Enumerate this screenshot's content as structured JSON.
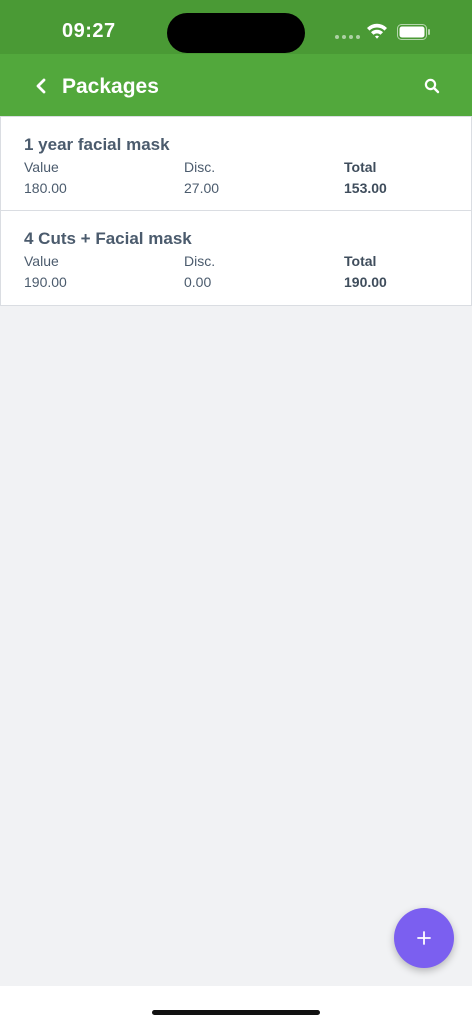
{
  "status_bar": {
    "time": "09:27"
  },
  "header": {
    "title": "Packages",
    "back_icon": "chevron-left-icon",
    "search_icon": "search-icon"
  },
  "packages": [
    {
      "name": "1 year facial mask",
      "value_label": "Value",
      "value": "180.00",
      "disc_label": "Disc.",
      "disc": "27.00",
      "total_label": "Total",
      "total": "153.00"
    },
    {
      "name": "4 Cuts + Facial mask",
      "value_label": "Value",
      "value": "190.00",
      "disc_label": "Disc.",
      "disc": "0.00",
      "total_label": "Total",
      "total": "190.00"
    }
  ],
  "fab": {
    "icon": "plus-icon",
    "color": "#7b5ff0"
  },
  "colors": {
    "status_bar": "#4a9a35",
    "app_bar": "#52a83c",
    "background": "#f1f2f4",
    "text": "#4b5b6d"
  }
}
